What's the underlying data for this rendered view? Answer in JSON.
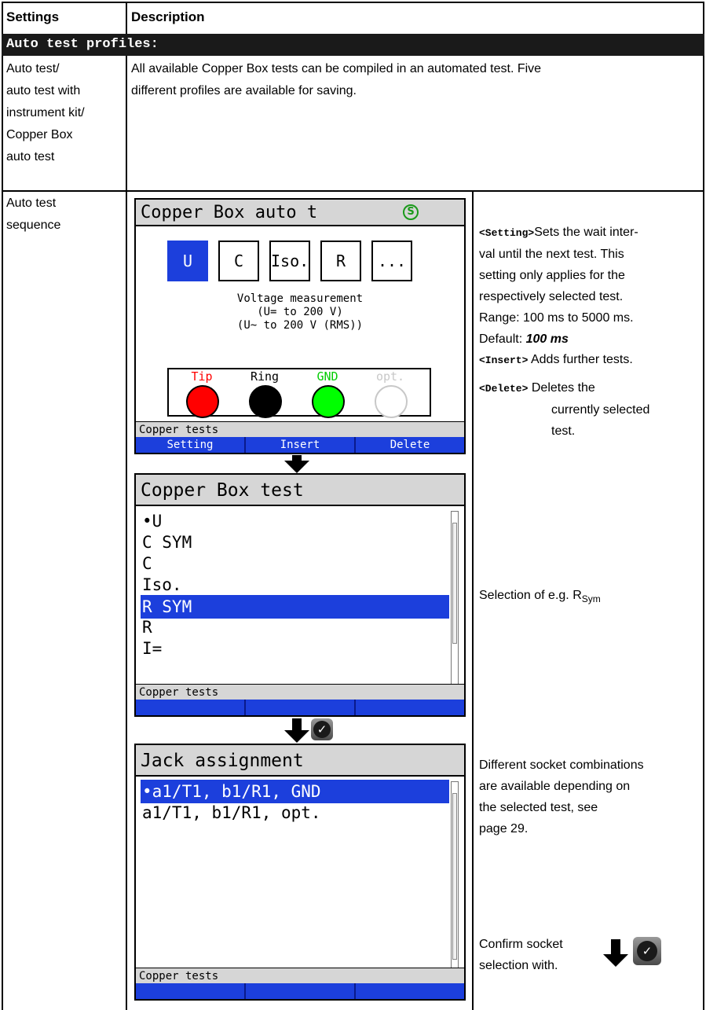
{
  "table": {
    "header_settings": "Settings",
    "header_description": "Description",
    "banner": "Auto test profiles:",
    "row1_setting": [
      "Auto test/",
      "auto test with",
      "instrument kit/",
      "Copper Box",
      "auto test"
    ],
    "row1_description": [
      "All available Copper Box tests can be compiled in an automated test. Five",
      "different profiles are available for saving."
    ],
    "row2_setting": [
      "Auto test",
      "sequence"
    ]
  },
  "screen1": {
    "title": "Copper Box auto t",
    "s_badge": "S",
    "tests": [
      "U",
      "C",
      "Iso.",
      "R",
      "..."
    ],
    "description": [
      "Voltage measurement",
      "(U= to 200 V)",
      "(U~ to 200 V (RMS))"
    ],
    "wires": [
      {
        "label": "Tip",
        "color": "#ff0000",
        "fill": "#ff0000"
      },
      {
        "label": "Ring",
        "color": "#000000",
        "fill": "#000000"
      },
      {
        "label": "GND",
        "color": "#00cc00",
        "fill": "#00ff00"
      },
      {
        "label": "opt.",
        "color": "#c8c8c8",
        "fill": "#ffffff"
      }
    ],
    "status": "Copper tests",
    "softkeys": [
      "Setting",
      "Insert",
      "Delete"
    ]
  },
  "screen2": {
    "title": "Copper Box test",
    "items": [
      "•U",
      " C SYM",
      " C",
      " Iso.",
      " R SYM",
      " R",
      " I="
    ],
    "selected_index": 4,
    "status": "Copper tests",
    "softkeys": [
      "",
      "",
      ""
    ]
  },
  "screen3": {
    "title": "Jack assignment",
    "items": [
      "•a1/T1, b1/R1, GND",
      " a1/T1, b1/R1, opt."
    ],
    "selected_index": 0,
    "status": "Copper tests",
    "softkeys": [
      "",
      "",
      ""
    ]
  },
  "right": {
    "setting_key": "<Setting>",
    "setting_text": [
      "Sets the wait inter-",
      "val until the next test. This",
      "setting only applies for the",
      "respectively selected test.",
      "Range: 100 ms to 5000 ms."
    ],
    "default_label": "Default: ",
    "default_value": "100 ms",
    "insert_key": "<Insert>",
    "insert_text": "Adds further tests.",
    "delete_key": "<Delete>",
    "delete_text": [
      "Deletes the",
      "currently selected",
      "test."
    ],
    "selection_text": "Selection of e.g. R",
    "selection_sub": "Sym",
    "socket_text": [
      "Different socket combinations",
      "are available depending on",
      "the selected test, see",
      "page 29."
    ],
    "confirm_text": [
      "Confirm socket",
      "selection with."
    ]
  },
  "icons": [
    "down-arrow-icon",
    "check-icon"
  ],
  "colors": {
    "accent_blue": "#1c3fdc",
    "title_gray": "#d6d6d6"
  }
}
